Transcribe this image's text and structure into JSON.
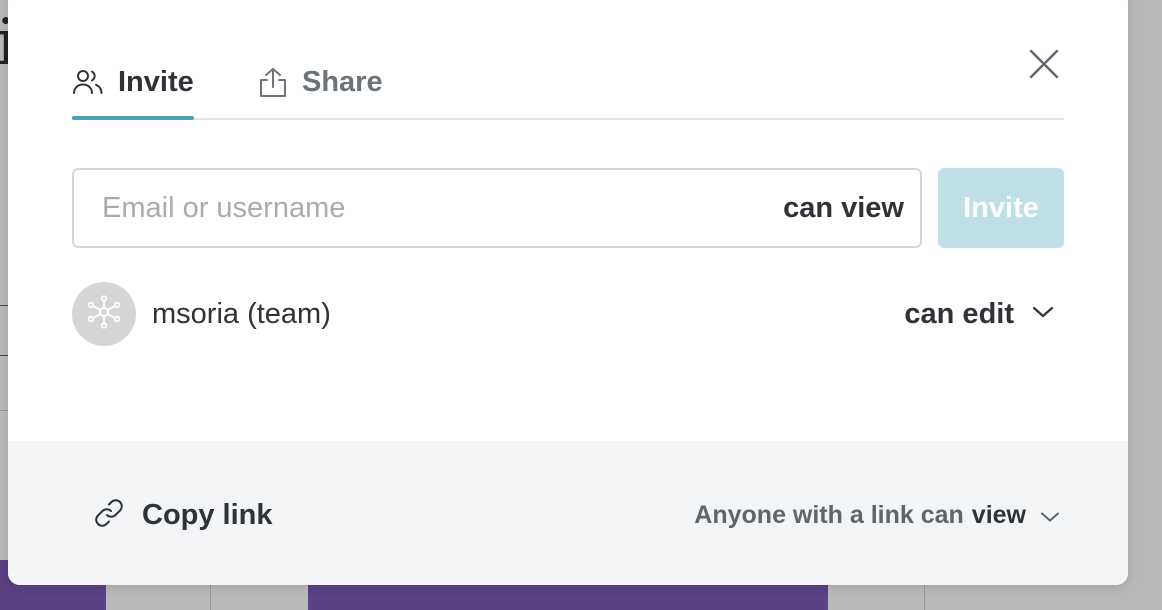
{
  "colors": {
    "accent": "#4aa3b5",
    "invite_button_disabled": "#bfe1e6",
    "footer_background": "#f3f4f6",
    "background_purple": "#5a4284"
  },
  "tabs": [
    {
      "label": "Invite",
      "icon": "people-icon",
      "active": true
    },
    {
      "label": "Share",
      "icon": "upload-icon",
      "active": false
    }
  ],
  "invite_form": {
    "placeholder": "Email or username",
    "value": "",
    "permission": "can view",
    "button_label": "Invite"
  },
  "members": [
    {
      "name": "msoria (team)",
      "permission": "can edit",
      "avatar_icon": "team-network-icon"
    }
  ],
  "footer": {
    "copy_link_label": "Copy link",
    "link_permission_prefix": "Anyone with a link can",
    "link_permission_value": "view"
  }
}
